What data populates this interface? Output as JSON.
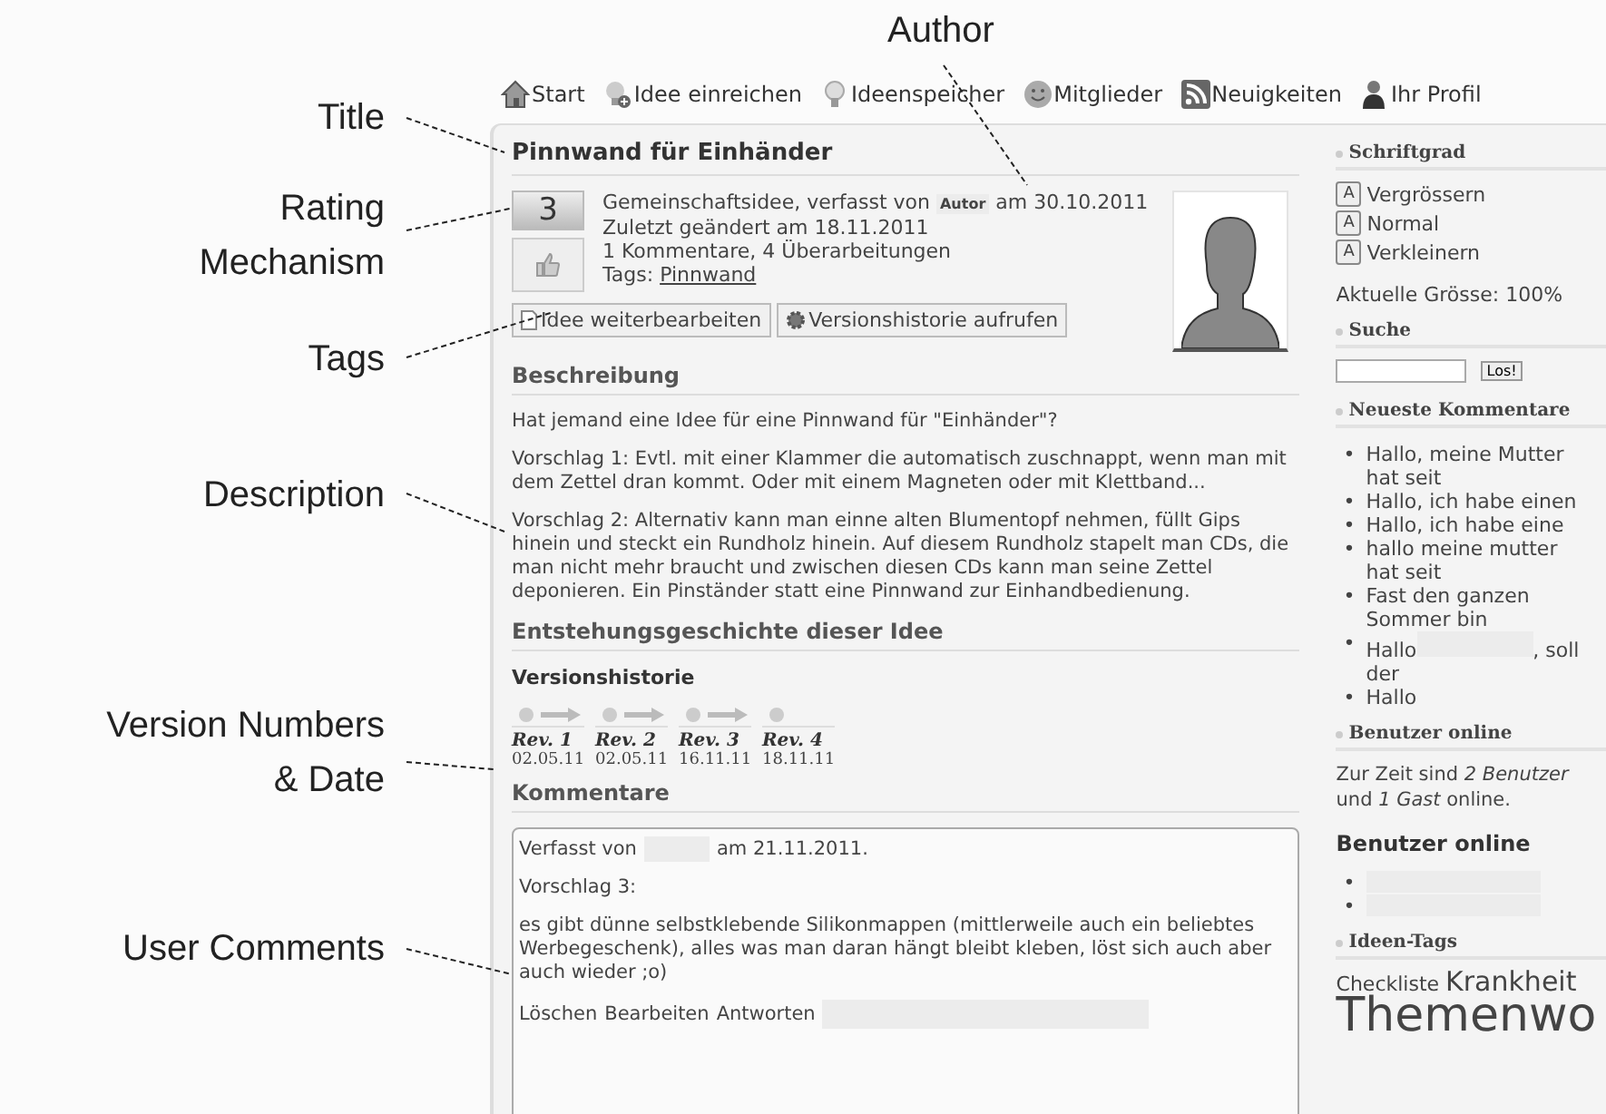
{
  "annotations": [
    {
      "lines": [
        "Author"
      ]
    },
    {
      "lines": [
        "Title"
      ]
    },
    {
      "lines": [
        "Rating",
        "Mechanism"
      ]
    },
    {
      "lines": [
        "Tags"
      ]
    },
    {
      "lines": [
        "Description"
      ]
    },
    {
      "lines": [
        "Version Numbers",
        "& Date"
      ]
    },
    {
      "lines": [
        "User Comments"
      ]
    }
  ],
  "nav": [
    {
      "kind": "house",
      "label": "Start"
    },
    {
      "kind": "bulb-plus",
      "label": "Idee einreichen"
    },
    {
      "kind": "bulb",
      "label": "Ideenspeicher"
    },
    {
      "kind": "smiley",
      "label": "Mitglieder"
    },
    {
      "kind": "rss",
      "label": "Neuigkeiten"
    },
    {
      "kind": "person",
      "label": "Ihr Profil"
    }
  ],
  "idea": {
    "title": "Pinnwand für Einhänder",
    "rating": "3",
    "meta": [
      "Gemeinschaftsidee, verfasst von **Autor** am 30.10.2011",
      "Zuletzt geändert am 18.11.2011",
      "1 Kommentare, 4 Überarbeitungen"
    ],
    "tags_label": "Tags:",
    "tag": "Pinnwand",
    "buttons": [
      {
        "kind": "edit",
        "label": "Idee weiterbearbeiten"
      },
      {
        "kind": "history",
        "label": "Versionshistorie aufrufen"
      }
    ]
  },
  "description": {
    "heading": "Beschreibung",
    "paragraphs": [
      "Hat jemand eine Idee für eine Pinnwand für \"Einhänder\"?",
      "Vorschlag 1: Evtl. mit einer Klammer die automatisch zuschnappt, wenn man mit dem Zettel dran kommt. Oder mit einem Magneten oder mit Klettband...",
      "Vorschlag 2: Alternativ kann man einne alten Blumentopf nehmen, füllt Gips hinein und steckt ein Rundholz hinein. Auf diesem Rundholz stapelt man CDs, die man nicht mehr braucht und zwischen diesen CDs kann man seine Zettel deponieren. Ein Pinständer statt eine Pinnwand zur Einhandbedienung."
    ]
  },
  "history": {
    "heading": "Entstehungsgeschichte dieser Idee",
    "subheading": "Versionshistorie",
    "revisions": [
      {
        "label": "Rev. 1",
        "date": "02.05.11"
      },
      {
        "label": "Rev. 2",
        "date": "02.05.11"
      },
      {
        "label": "Rev. 3",
        "date": "16.11.11"
      },
      {
        "label": "Rev. 4",
        "date": "18.11.11"
      }
    ]
  },
  "comments": {
    "heading": "Kommentare",
    "items": [
      {
        "by": "Verfasst von",
        "date": "am 21.11.2011.",
        "paragraphs": [
          "Vorschlag 3:",
          "es gibt dünne selbstklebende Silikonmappen (mittlerweile auch ein beliebtes Werbegeschenk), alles was man daran hängt bleibt kleben, löst sich auch aber auch wieder ;o)"
        ],
        "actions": [
          "Löschen",
          "Bearbeiten",
          "Antworten"
        ]
      }
    ]
  },
  "sidebar": {
    "font_size": {
      "heading": "Schriftgrad",
      "controls": [
        {
          "icon": "A",
          "label": "Vergrössern"
        },
        {
          "icon": "A",
          "label": "Normal"
        },
        {
          "icon": "A",
          "label": "Verkleinern"
        }
      ],
      "current": "Aktuelle Grösse: 100%"
    },
    "search": {
      "heading": "Suche",
      "button": "Los!"
    },
    "recent_comments": {
      "heading": "Neueste Kommentare",
      "items": [
        {
          "marker": "•",
          "parts": [
            "Hallo, meine Mutter hat seit"
          ]
        },
        {
          "marker": "•",
          "parts": [
            "Hallo, ich habe einen"
          ]
        },
        {
          "marker": "•",
          "parts": [
            "Hallo, ich habe eine"
          ]
        },
        {
          "marker": "•",
          "parts": [
            "hallo meine mutter hat seit"
          ]
        },
        {
          "marker": "•",
          "parts": [
            "Fast den ganzen Sommer bin"
          ]
        },
        {
          "marker": "•",
          "parts": [
            "Hallo",
            ", soll der"
          ]
        },
        {
          "marker": "•",
          "parts": [
            "Hallo"
          ]
        }
      ]
    },
    "online": {
      "heading": "Benutzer online",
      "lines": [
        "Zur Zeit sind *2 Benutzer*",
        "und *1 Gast* online."
      ],
      "subheading": "Benutzer online",
      "users": [
        {
          "kind": "redacted",
          "marker": "•"
        },
        {
          "kind": "redacted",
          "marker": "•"
        }
      ]
    },
    "tags": {
      "heading": "Ideen-Tags",
      "items": [
        {
          "kind": "small",
          "text": "Checkliste"
        },
        {
          "kind": "medium",
          "text": "Krankheit"
        },
        {
          "kind": "large",
          "text": "Themenwo"
        }
      ]
    }
  }
}
